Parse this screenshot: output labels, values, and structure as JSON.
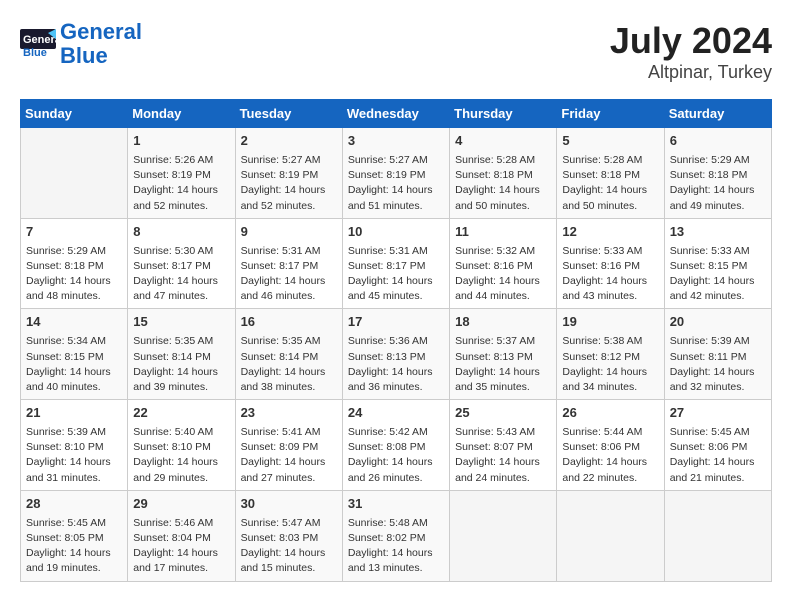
{
  "header": {
    "logo_line1": "General",
    "logo_line2": "Blue",
    "month": "July 2024",
    "location": "Altpinar, Turkey"
  },
  "weekdays": [
    "Sunday",
    "Monday",
    "Tuesday",
    "Wednesday",
    "Thursday",
    "Friday",
    "Saturday"
  ],
  "weeks": [
    [
      {
        "day": "",
        "info": ""
      },
      {
        "day": "1",
        "info": "Sunrise: 5:26 AM\nSunset: 8:19 PM\nDaylight: 14 hours\nand 52 minutes."
      },
      {
        "day": "2",
        "info": "Sunrise: 5:27 AM\nSunset: 8:19 PM\nDaylight: 14 hours\nand 52 minutes."
      },
      {
        "day": "3",
        "info": "Sunrise: 5:27 AM\nSunset: 8:19 PM\nDaylight: 14 hours\nand 51 minutes."
      },
      {
        "day": "4",
        "info": "Sunrise: 5:28 AM\nSunset: 8:18 PM\nDaylight: 14 hours\nand 50 minutes."
      },
      {
        "day": "5",
        "info": "Sunrise: 5:28 AM\nSunset: 8:18 PM\nDaylight: 14 hours\nand 50 minutes."
      },
      {
        "day": "6",
        "info": "Sunrise: 5:29 AM\nSunset: 8:18 PM\nDaylight: 14 hours\nand 49 minutes."
      }
    ],
    [
      {
        "day": "7",
        "info": "Sunrise: 5:29 AM\nSunset: 8:18 PM\nDaylight: 14 hours\nand 48 minutes."
      },
      {
        "day": "8",
        "info": "Sunrise: 5:30 AM\nSunset: 8:17 PM\nDaylight: 14 hours\nand 47 minutes."
      },
      {
        "day": "9",
        "info": "Sunrise: 5:31 AM\nSunset: 8:17 PM\nDaylight: 14 hours\nand 46 minutes."
      },
      {
        "day": "10",
        "info": "Sunrise: 5:31 AM\nSunset: 8:17 PM\nDaylight: 14 hours\nand 45 minutes."
      },
      {
        "day": "11",
        "info": "Sunrise: 5:32 AM\nSunset: 8:16 PM\nDaylight: 14 hours\nand 44 minutes."
      },
      {
        "day": "12",
        "info": "Sunrise: 5:33 AM\nSunset: 8:16 PM\nDaylight: 14 hours\nand 43 minutes."
      },
      {
        "day": "13",
        "info": "Sunrise: 5:33 AM\nSunset: 8:15 PM\nDaylight: 14 hours\nand 42 minutes."
      }
    ],
    [
      {
        "day": "14",
        "info": "Sunrise: 5:34 AM\nSunset: 8:15 PM\nDaylight: 14 hours\nand 40 minutes."
      },
      {
        "day": "15",
        "info": "Sunrise: 5:35 AM\nSunset: 8:14 PM\nDaylight: 14 hours\nand 39 minutes."
      },
      {
        "day": "16",
        "info": "Sunrise: 5:35 AM\nSunset: 8:14 PM\nDaylight: 14 hours\nand 38 minutes."
      },
      {
        "day": "17",
        "info": "Sunrise: 5:36 AM\nSunset: 8:13 PM\nDaylight: 14 hours\nand 36 minutes."
      },
      {
        "day": "18",
        "info": "Sunrise: 5:37 AM\nSunset: 8:13 PM\nDaylight: 14 hours\nand 35 minutes."
      },
      {
        "day": "19",
        "info": "Sunrise: 5:38 AM\nSunset: 8:12 PM\nDaylight: 14 hours\nand 34 minutes."
      },
      {
        "day": "20",
        "info": "Sunrise: 5:39 AM\nSunset: 8:11 PM\nDaylight: 14 hours\nand 32 minutes."
      }
    ],
    [
      {
        "day": "21",
        "info": "Sunrise: 5:39 AM\nSunset: 8:10 PM\nDaylight: 14 hours\nand 31 minutes."
      },
      {
        "day": "22",
        "info": "Sunrise: 5:40 AM\nSunset: 8:10 PM\nDaylight: 14 hours\nand 29 minutes."
      },
      {
        "day": "23",
        "info": "Sunrise: 5:41 AM\nSunset: 8:09 PM\nDaylight: 14 hours\nand 27 minutes."
      },
      {
        "day": "24",
        "info": "Sunrise: 5:42 AM\nSunset: 8:08 PM\nDaylight: 14 hours\nand 26 minutes."
      },
      {
        "day": "25",
        "info": "Sunrise: 5:43 AM\nSunset: 8:07 PM\nDaylight: 14 hours\nand 24 minutes."
      },
      {
        "day": "26",
        "info": "Sunrise: 5:44 AM\nSunset: 8:06 PM\nDaylight: 14 hours\nand 22 minutes."
      },
      {
        "day": "27",
        "info": "Sunrise: 5:45 AM\nSunset: 8:06 PM\nDaylight: 14 hours\nand 21 minutes."
      }
    ],
    [
      {
        "day": "28",
        "info": "Sunrise: 5:45 AM\nSunset: 8:05 PM\nDaylight: 14 hours\nand 19 minutes."
      },
      {
        "day": "29",
        "info": "Sunrise: 5:46 AM\nSunset: 8:04 PM\nDaylight: 14 hours\nand 17 minutes."
      },
      {
        "day": "30",
        "info": "Sunrise: 5:47 AM\nSunset: 8:03 PM\nDaylight: 14 hours\nand 15 minutes."
      },
      {
        "day": "31",
        "info": "Sunrise: 5:48 AM\nSunset: 8:02 PM\nDaylight: 14 hours\nand 13 minutes."
      },
      {
        "day": "",
        "info": ""
      },
      {
        "day": "",
        "info": ""
      },
      {
        "day": "",
        "info": ""
      }
    ]
  ]
}
